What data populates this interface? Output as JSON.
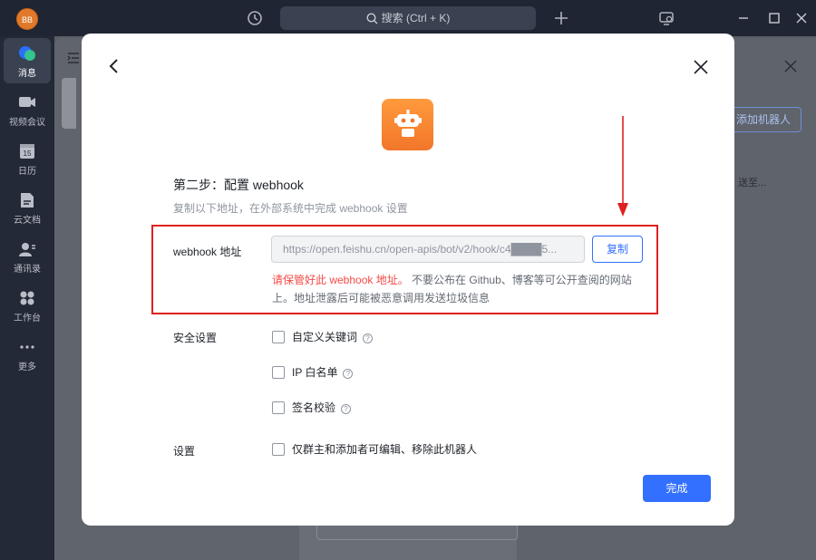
{
  "titlebar": {
    "avatar_initials": "BB",
    "search_placeholder": "搜索 (Ctrl + K)"
  },
  "sidebar": {
    "items": [
      {
        "label": "消息",
        "icon": "message-icon",
        "active": true
      },
      {
        "label": "视频会议",
        "icon": "video-icon"
      },
      {
        "label": "日历",
        "icon": "calendar-icon",
        "day": "15"
      },
      {
        "label": "云文档",
        "icon": "docs-icon"
      },
      {
        "label": "通讯录",
        "icon": "contacts-icon"
      },
      {
        "label": "工作台",
        "icon": "workplace-icon"
      },
      {
        "label": "更多",
        "icon": "more-icon"
      }
    ]
  },
  "background": {
    "add_bot_label": "添加机器人",
    "send_to_text": "送至..."
  },
  "modal": {
    "step_title": "第二步：配置 webhook",
    "step_desc": "复制以下地址，在外部系统中完成 webhook 设置",
    "webhook_label": "webhook 地址",
    "webhook_value": "https://open.feishu.cn/open-apis/bot/v2/hook/c4████5...",
    "copy_label": "复制",
    "warning_red": "请保管好此 webhook 地址。",
    "warning_rest": " 不要公布在 Github、博客等可公开查阅的网站上。地址泄露后可能被恶意调用发送垃圾信息",
    "security_label": "安全设置",
    "security_options": [
      "自定义关键词",
      "IP 白名单",
      "签名校验"
    ],
    "settings_label": "设置",
    "settings_option": "仅群主和添加者可编辑、移除此机器人",
    "done_label": "完成"
  },
  "colors": {
    "accent": "#3370ff",
    "warning": "#f54a45",
    "annotation": "#e02020",
    "bot_orange": "#f2762a"
  }
}
